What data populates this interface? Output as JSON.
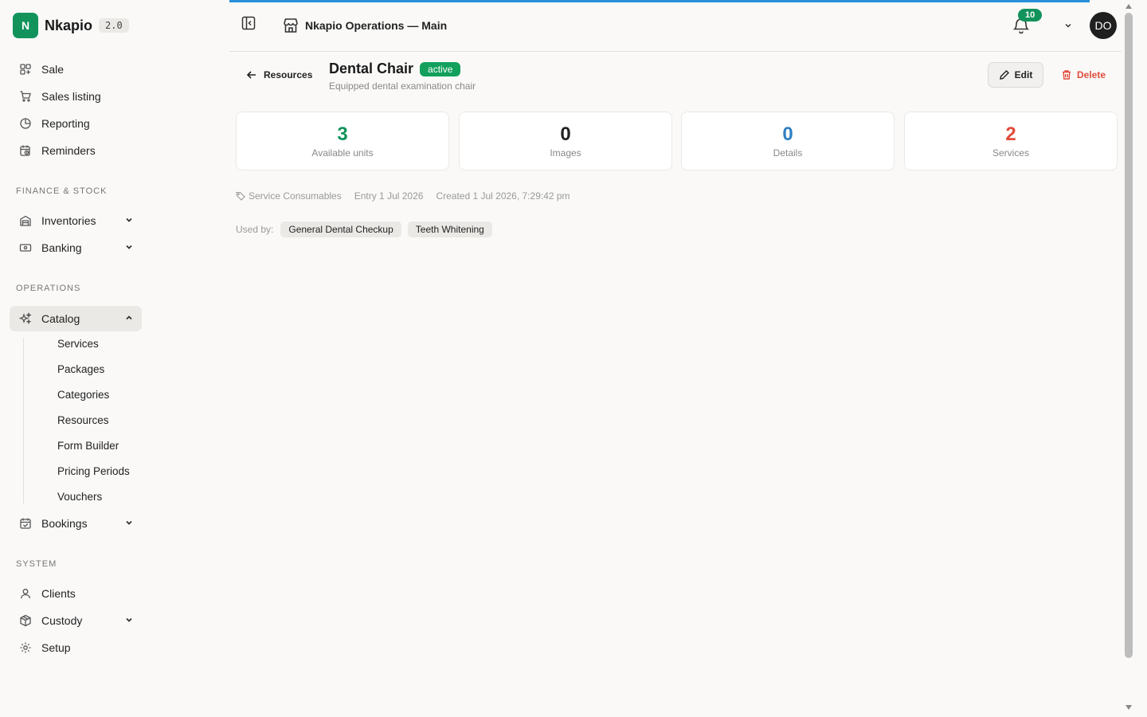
{
  "brand": {
    "logo_letter": "N",
    "name": "Nkapio",
    "version": "2.0",
    "color": "#12935c"
  },
  "sidebar": {
    "top_items": [
      {
        "label": "Sale",
        "icon": "grid-plus-icon"
      },
      {
        "label": "Sales listing",
        "icon": "cart-icon"
      },
      {
        "label": "Reporting",
        "icon": "pie-chart-icon"
      },
      {
        "label": "Reminders",
        "icon": "calendar-clock-icon"
      }
    ],
    "sections": {
      "finance": "FINANCE & STOCK",
      "operations": "OPERATIONS",
      "system": "SYSTEM"
    },
    "finance_items": [
      {
        "label": "Inventories",
        "icon": "warehouse-icon"
      },
      {
        "label": "Banking",
        "icon": "banknote-icon"
      }
    ],
    "catalog": {
      "label": "Catalog",
      "icon": "sparkles-icon",
      "expanded": true,
      "children": [
        "Services",
        "Packages",
        "Categories",
        "Resources",
        "Form Builder",
        "Pricing Periods",
        "Vouchers"
      ]
    },
    "bookings": {
      "label": "Bookings",
      "icon": "calendar-check-icon"
    },
    "system_items": [
      {
        "label": "Clients",
        "icon": "user-icon"
      },
      {
        "label": "Custody",
        "icon": "box-icon"
      },
      {
        "label": "Setup",
        "icon": "gear-icon"
      }
    ]
  },
  "header": {
    "workspace_name": "Nkapio Operations — Main",
    "notification_count": "10",
    "avatar_initials": "DO"
  },
  "page": {
    "back_label": "Resources",
    "title": "Dental Chair",
    "status": "active",
    "subtitle": "Equipped dental examination chair",
    "edit_label": "Edit",
    "delete_label": "Delete"
  },
  "stats": [
    {
      "value": "3",
      "label": "Available units",
      "color": "#12935c"
    },
    {
      "value": "0",
      "label": "Images",
      "color": "#222222"
    },
    {
      "value": "0",
      "label": "Details",
      "color": "#2f7fc2"
    },
    {
      "value": "2",
      "label": "Services",
      "color": "#e04c3c"
    }
  ],
  "meta": {
    "category": "Service Consumables",
    "entry": "Entry 1 Jul 2026",
    "created": "Created 1 Jul 2026, 7:29:42 pm"
  },
  "used_by": {
    "label": "Used by:",
    "items": [
      "General Dental Checkup",
      "Teeth Whitening"
    ]
  }
}
